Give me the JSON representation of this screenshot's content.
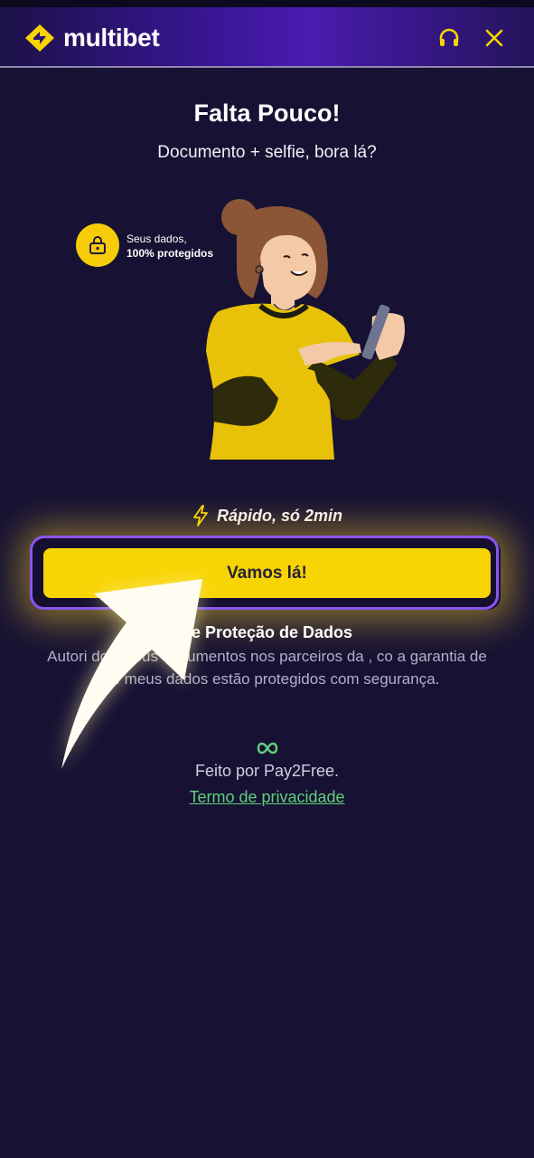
{
  "header": {
    "brand": "multibet",
    "icons": {
      "support": "headset-icon",
      "close": "close-icon"
    },
    "accent": "#f7d403"
  },
  "content": {
    "title": "Falta Pouco!",
    "subtitle": "Documento + selfie, bora lá?",
    "security_badge": {
      "line1": "Seus dados,",
      "line2": "100% protegidos",
      "icon": "lock-icon"
    },
    "speed_label": "Rápido, só 2min",
    "speed_icon": "lightning-icon",
    "cta_label": "Vamos lá!",
    "protection_title": "de Proteção de Dados",
    "protection_text": "Autori dos meus documentos nos parceiros da , co a garantia de que meus dados estão protegidos com segurança."
  },
  "footer": {
    "provider_icon": "pay2free-logo-icon",
    "made_by": "Feito por Pay2Free.",
    "privacy_link": "Termo de privacidade"
  },
  "colors": {
    "background": "#171233",
    "button": "#f7d403",
    "link": "#5fcf7b",
    "button_border": "#8a55f0"
  }
}
